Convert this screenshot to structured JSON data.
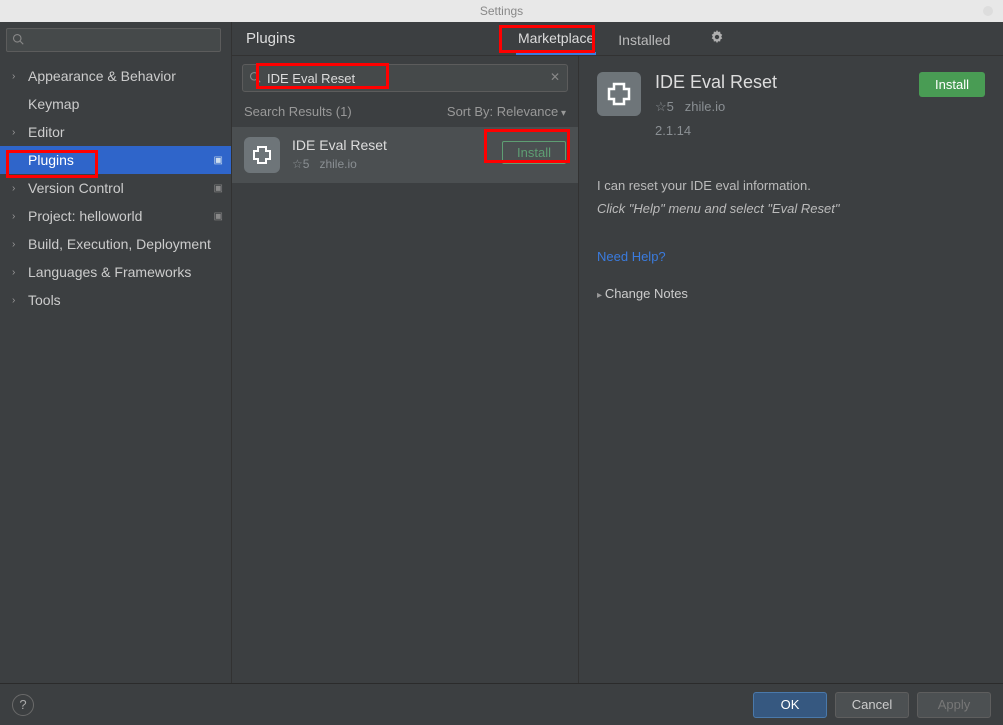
{
  "window": {
    "title": "Settings"
  },
  "sidebar": {
    "search_placeholder": "",
    "items": [
      {
        "label": "Appearance & Behavior",
        "expandable": true
      },
      {
        "label": "Keymap",
        "expandable": false
      },
      {
        "label": "Editor",
        "expandable": true
      },
      {
        "label": "Plugins",
        "expandable": false,
        "selected": true,
        "tagged": true
      },
      {
        "label": "Version Control",
        "expandable": true,
        "tagged": true
      },
      {
        "label": "Project: helloworld",
        "expandable": true,
        "tagged": true
      },
      {
        "label": "Build, Execution, Deployment",
        "expandable": true
      },
      {
        "label": "Languages & Frameworks",
        "expandable": true
      },
      {
        "label": "Tools",
        "expandable": true
      }
    ]
  },
  "header": {
    "title": "Plugins",
    "tabs": [
      {
        "label": "Marketplace",
        "active": true
      },
      {
        "label": "Installed",
        "active": false
      }
    ]
  },
  "middle": {
    "search_value": "IDE Eval Reset",
    "results_label": "Search Results (1)",
    "sort_label": "Sort By: Relevance",
    "items": [
      {
        "name": "IDE Eval Reset",
        "rating_label": "☆5",
        "vendor": "zhile.io",
        "install_label": "Install"
      }
    ]
  },
  "detail": {
    "name": "IDE Eval Reset",
    "rating_label": "☆5",
    "vendor": "zhile.io",
    "version": "2.1.14",
    "install_label": "Install",
    "desc_line1": "I can reset your IDE eval information.",
    "desc_line2": "Click \"Help\" menu and select \"Eval Reset\"",
    "help_link": "Need Help?",
    "change_notes": "Change Notes"
  },
  "footer": {
    "ok": "OK",
    "cancel": "Cancel",
    "apply": "Apply"
  }
}
